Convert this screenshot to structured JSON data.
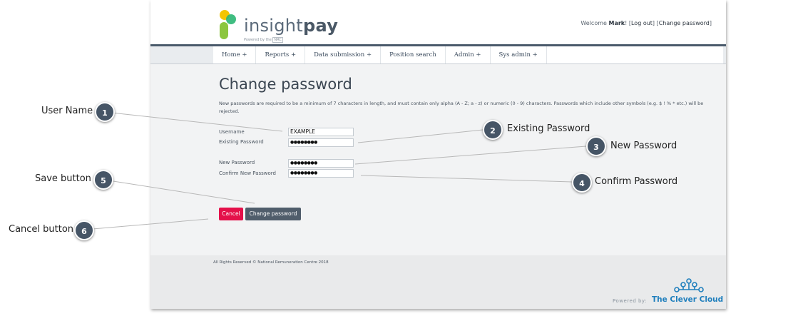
{
  "header": {
    "brand_prefix": "insight",
    "brand_bold": "pay",
    "brand_sub": "Powered by the",
    "brand_sub_box": "NRC",
    "welcome_prefix": "Welcome",
    "user": "Mark",
    "welcome_suffix": "! [",
    "logout": "Log out",
    "sep": "] [",
    "change_password": "Change password",
    "close_bracket": "]"
  },
  "nav": [
    "Home +",
    "Reports +",
    "Data submission +",
    "Position search",
    "Admin +",
    "Sys admin +"
  ],
  "main": {
    "title": "Change password",
    "description": "New passwords are required to be a minimum of 7 characters in length, and must contain only alpha (A - Z; a - z) or numeric (0 - 9) characters. Passwords which include other symbols (e.g. $ ! % * etc.) will be rejected."
  },
  "form": {
    "username_label": "Username",
    "username_value": "EXAMPLE",
    "existing_label": "Existing Password",
    "existing_value": "●●●●●●●●",
    "new_label": "New Password",
    "new_value": "●●●●●●●●",
    "confirm_label": "Confirm New Password",
    "confirm_value": "●●●●●●●●"
  },
  "buttons": {
    "cancel": "Cancel",
    "change": "Change password"
  },
  "footer": {
    "copyright": "All Rights Reserved © National Remuneration Centre 2018",
    "powered": "Powered by:",
    "company": "The Clever Cloud"
  },
  "callouts": [
    {
      "num": "1",
      "label": "User Name"
    },
    {
      "num": "2",
      "label": "Existing Password"
    },
    {
      "num": "3",
      "label": "New Password"
    },
    {
      "num": "4",
      "label": "Confirm Password"
    },
    {
      "num": "5",
      "label": "Save button"
    },
    {
      "num": "6",
      "label": "Cancel button"
    }
  ],
  "colors": {
    "accent": "#e4104a",
    "nav_border": "#4a5a6b",
    "callout": "#465566",
    "brand_blue": "#1f7fbd",
    "logo_green": "#8cc63f",
    "logo_yellow": "#f2c500"
  }
}
